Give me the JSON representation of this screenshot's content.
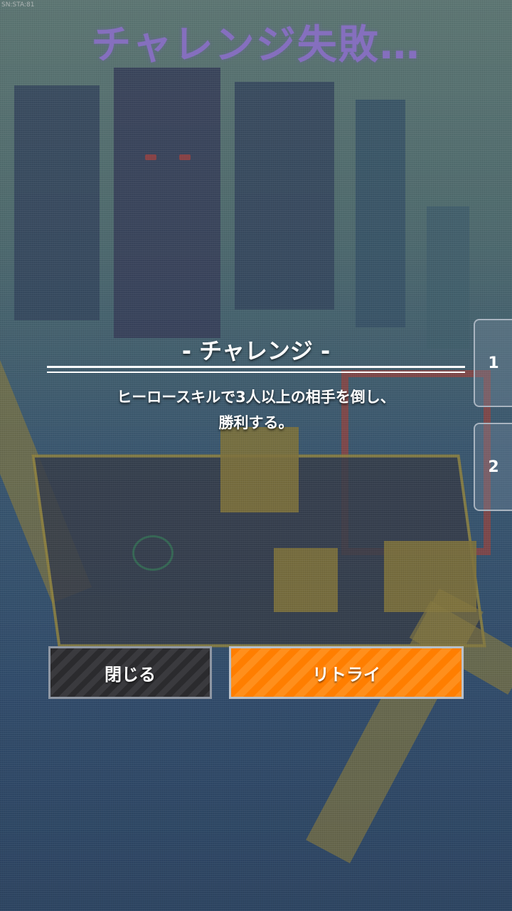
{
  "status_bar": {
    "label": "SN:STA:81"
  },
  "result": {
    "title": "チャレンジ失敗…"
  },
  "challenge": {
    "header": "- チャレンジ -",
    "line1": "ヒーロースキルで3人以上の相手を倒し、",
    "line2": "勝利する。"
  },
  "side_tabs": [
    {
      "label": "1"
    },
    {
      "label": "2"
    }
  ],
  "buttons": {
    "close_label": "閉じる",
    "retry_label": "リトライ"
  },
  "colors": {
    "title": "#8a6fc7",
    "retry_button": "#ff7e00",
    "close_button": "#2b2b2e"
  }
}
